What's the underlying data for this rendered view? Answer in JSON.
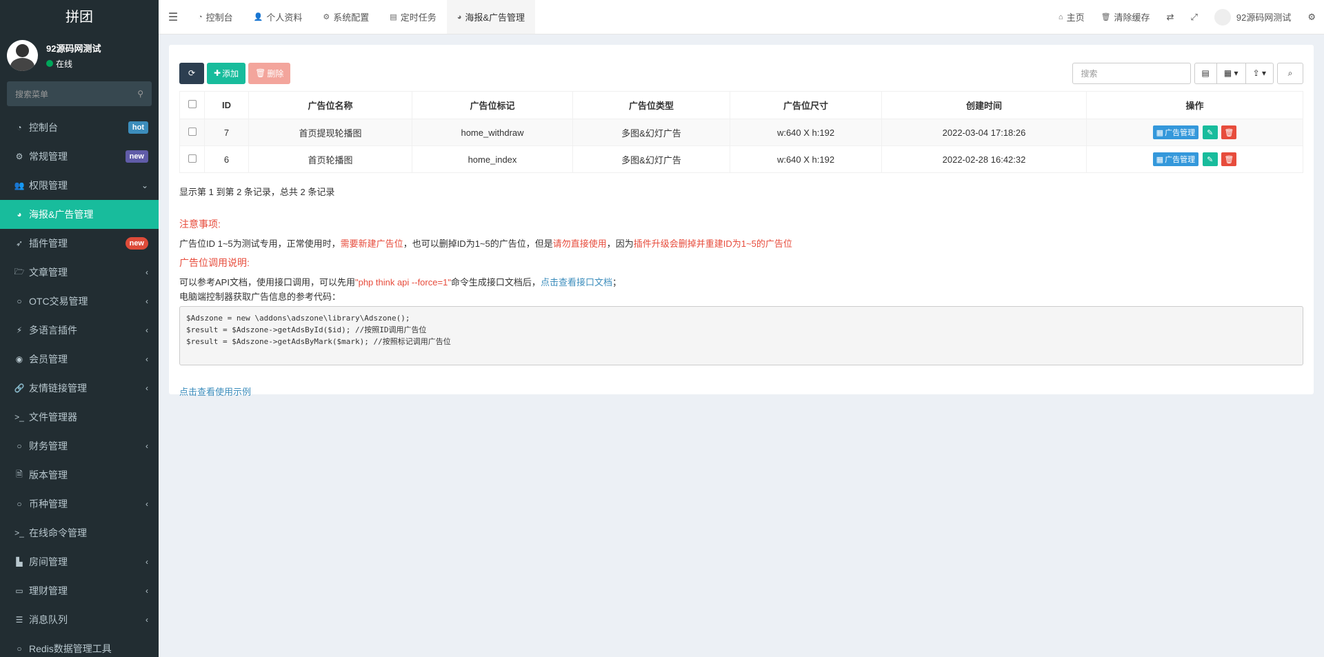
{
  "sidebar": {
    "logo": "拼团",
    "user_name": "92源码网测试",
    "user_status": "在线",
    "search_placeholder": "搜索菜单",
    "items": [
      {
        "label": "控制台",
        "badge": "hot"
      },
      {
        "label": "常规管理",
        "badge": "new"
      },
      {
        "label": "权限管理",
        "chevron": "⌄"
      },
      {
        "label": "海报&广告管理"
      },
      {
        "label": "插件管理",
        "badge": "new"
      },
      {
        "label": "文章管理",
        "chevron": "‹"
      },
      {
        "label": "OTC交易管理",
        "chevron": "‹"
      },
      {
        "label": "多语言插件",
        "chevron": "‹"
      },
      {
        "label": "会员管理",
        "chevron": "‹"
      },
      {
        "label": "友情链接管理",
        "chevron": "‹"
      },
      {
        "label": "文件管理器"
      },
      {
        "label": "财务管理",
        "chevron": "‹"
      },
      {
        "label": "版本管理"
      },
      {
        "label": "币种管理",
        "chevron": "‹"
      },
      {
        "label": "在线命令管理"
      },
      {
        "label": "房间管理",
        "chevron": "‹"
      },
      {
        "label": "理财管理",
        "chevron": "‹"
      },
      {
        "label": "消息队列",
        "chevron": "‹"
      },
      {
        "label": "Redis数据管理工具"
      }
    ]
  },
  "header": {
    "tabs": [
      "控制台",
      "个人资料",
      "系统配置",
      "定时任务",
      "海报&广告管理"
    ],
    "home": "主页",
    "clear_cache": "清除缓存",
    "user_name": "92源码网测试"
  },
  "toolbar": {
    "add_label": "添加",
    "delete_label": "删除",
    "search_placeholder": "搜索"
  },
  "table": {
    "headers": [
      "ID",
      "广告位名称",
      "广告位标记",
      "广告位类型",
      "广告位尺寸",
      "创建时间",
      "操作"
    ],
    "rows": [
      {
        "id": "7",
        "name": "首页提现轮播图",
        "mark": "home_withdraw",
        "type": "多图&幻灯广告",
        "size": "w:640 X h:192",
        "created": "2022-03-04 17:18:26"
      },
      {
        "id": "6",
        "name": "首页轮播图",
        "mark": "home_index",
        "type": "多图&幻灯广告",
        "size": "w:640 X h:192",
        "created": "2022-02-28 16:42:32"
      }
    ],
    "manage_label": "广告管理"
  },
  "pagination": "显示第 1 到第 2 条记录，总共 2 条记录",
  "notice": {
    "title": "注意事项:",
    "p1": "广告位ID 1~5为测试专用，正常使用时，",
    "r1": "需要新建广告位",
    "p2": "，也可以删掉ID为1~5的广告位，但是",
    "r2": "请勿直接使用",
    "p3": "，因为",
    "r3": "插件升级会删掉并重建ID为1~5的广告位"
  },
  "usage": {
    "title": "广告位调用说明:",
    "l1a": "可以参考API文档，使用接口调用，可以先用",
    "l1r": "\"php think api --force=1\"",
    "l1b": "命令生成接口文档后，",
    "l1link": "点击查看接口文档",
    "l1c": "；",
    "l2": "电脑端控制器获取广告信息的参考代码：",
    "code": "$Adszone = new \\addons\\adszone\\library\\Adszone();\n$result = $Adszone->getAdsById($id); //按照ID调用广告位\n$result = $Adszone->getAdsByMark($mark); //按照标记调用广告位",
    "example_link": "点击查看使用示例"
  }
}
